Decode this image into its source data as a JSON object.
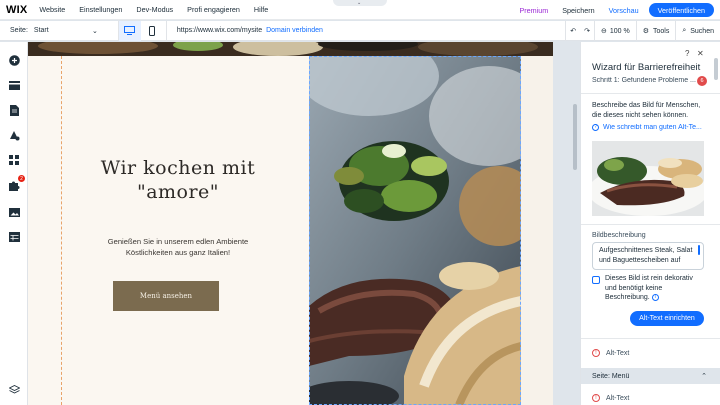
{
  "topbar": {
    "logo": "WIX",
    "menu": [
      "Website",
      "Einstellungen",
      "Dev-Modus",
      "Profi engagieren",
      "Hilfe"
    ],
    "premium": "Premium",
    "save": "Speichern",
    "preview": "Vorschau",
    "publish": "Veröffentlichen"
  },
  "subbar": {
    "page_label": "Seite:",
    "page_value": "Start",
    "url": "https://www.wix.com/mysite",
    "domain_link": "Domain verbinden",
    "zoom": "100 %",
    "tools": "Tools",
    "search": "Suchen"
  },
  "leftbar": {
    "apps_badge": "2"
  },
  "canvas": {
    "headline_line1": "Wir kochen mit",
    "headline_line2": "\"amore\"",
    "sub_line1": "Genießen Sie in unserem edlen Ambiente",
    "sub_line2": "Köstlichkeiten aus ganz Italien!",
    "menu_button": "Menü ansehen"
  },
  "panel": {
    "title": "Wizard für Barrierefreiheit",
    "step": "Schritt 1: Gefundene Probleme ...",
    "step_badge": "6",
    "description": "Beschreibe das Bild für Menschen, die dieses nicht sehen können.",
    "help_link": "Wie schreibt man guten Alt-Te...",
    "field_label": "Bildbeschreibung",
    "field_value": "Aufgeschnittenes Steak, Salat und Baguettescheiben auf",
    "checkbox_label": "Dieses Bild ist rein dekorativ und benötigt keine Beschreibung.",
    "alt_button": "Alt-Text einrichten",
    "alt_row1": "Alt-Text",
    "section": "Seite: Menü",
    "alt_row2": "Alt-Text"
  },
  "colors": {
    "accent": "#116dff",
    "premium": "#9a27d5",
    "error": "#e14b4b",
    "button_brown": "#7b6b4f"
  }
}
